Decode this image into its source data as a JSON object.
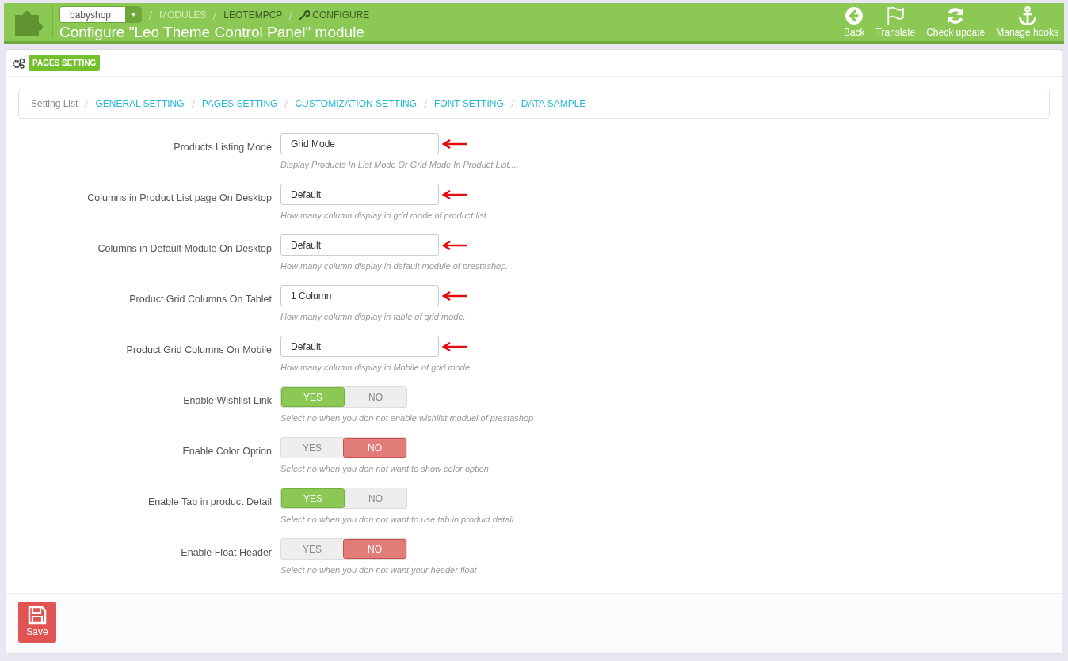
{
  "header": {
    "shop_select": "babyshop",
    "breadcrumb": [
      {
        "label": "MODULES",
        "kind": "muted"
      },
      {
        "label": "LEOTEMPCP",
        "kind": "plain"
      },
      {
        "label": "CONFIGURE",
        "kind": "wrench"
      }
    ],
    "title": "Configure \"Leo Theme Control Panel\" module",
    "toolbar": [
      {
        "label": "Back",
        "kind": "back"
      },
      {
        "label": "Translate",
        "kind": "flag"
      },
      {
        "label": "Check update",
        "kind": "refresh"
      },
      {
        "label": "Manage hooks",
        "kind": "anchor"
      }
    ]
  },
  "panel": {
    "heading": "PAGES SETTING",
    "nav": [
      {
        "label": "Setting List",
        "kind": "text"
      },
      {
        "label": "GENERAL SETTING",
        "kind": "link"
      },
      {
        "label": "PAGES SETTING",
        "kind": "link"
      },
      {
        "label": "CUSTOMIZATION SETTING",
        "kind": "link"
      },
      {
        "label": "FONT SETTING",
        "kind": "link"
      },
      {
        "label": "DATA SAMPLE",
        "kind": "link"
      }
    ],
    "fields": [
      {
        "kind": "select",
        "label": "Products Listing Mode",
        "value": "Grid Mode",
        "hint": "Display Products In List Mode Or Grid Mode In Product List....",
        "marked": true
      },
      {
        "kind": "select",
        "label": "Columns in Product List page On Desktop",
        "value": "Default",
        "hint": "How many column display in grid mode of product list.",
        "marked": true
      },
      {
        "kind": "select",
        "label": "Columns in Default Module On Desktop",
        "value": "Default",
        "hint": "How many column display in default module of prestashop.",
        "marked": true
      },
      {
        "kind": "select",
        "label": "Product Grid Columns On Tablet",
        "value": "1 Column",
        "hint": "How many column display in table of grid mode.",
        "marked": true
      },
      {
        "kind": "select",
        "label": "Product Grid Columns On Mobile",
        "value": "Default",
        "hint": "How many column display in Mobile of grid mode",
        "marked": true
      },
      {
        "kind": "switch",
        "label": "Enable Wishlist Link",
        "yes": "YES",
        "no": "NO",
        "on": true,
        "hint": "Select no when you don not enable wishlist moduel of prestashop"
      },
      {
        "kind": "switch",
        "label": "Enable Color Option",
        "yes": "YES",
        "no": "NO",
        "on": false,
        "hint": "Select no when you don not want to show color option"
      },
      {
        "kind": "switch",
        "label": "Enable Tab in product Detail",
        "yes": "YES",
        "no": "NO",
        "on": true,
        "hint": "Select no when you don not want to use tab in product detail"
      },
      {
        "kind": "switch",
        "label": "Enable Float Header",
        "yes": "YES",
        "no": "NO",
        "on": false,
        "hint": "Select no when you don not want your header float"
      }
    ],
    "save": "Save"
  }
}
